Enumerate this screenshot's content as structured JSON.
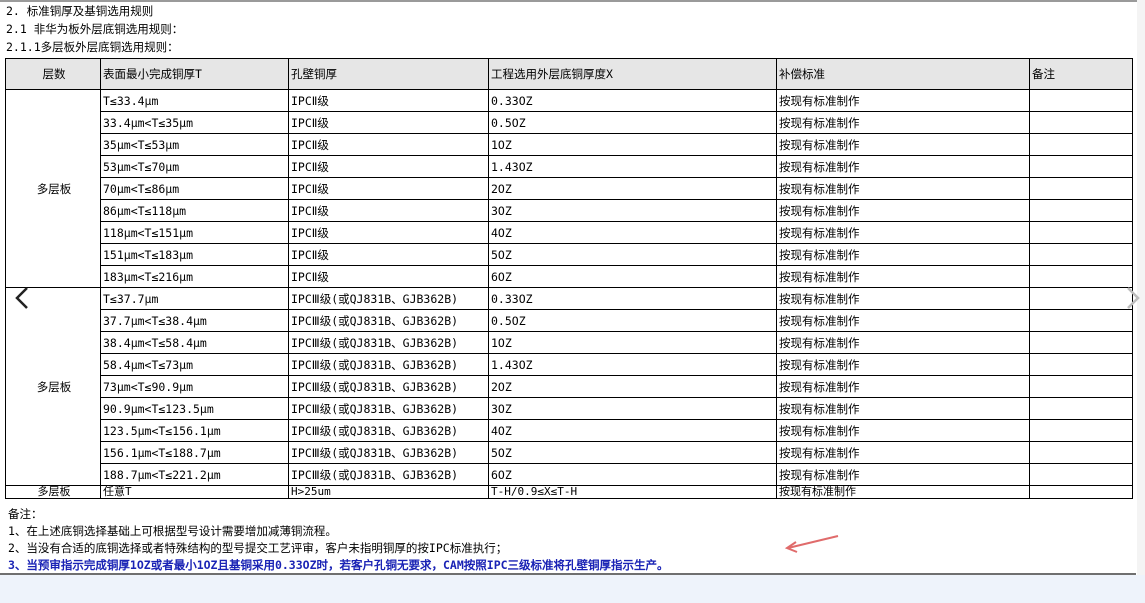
{
  "headings": [
    "2. 标准铜厚及基铜选用规则",
    "2.1 非华为板外层底铜选用规则：",
    "2.1.1多层板外层底铜选用规则："
  ],
  "table": {
    "columns": [
      "层数",
      "表面最小完成铜厚T",
      "孔壁铜厚",
      "工程选用外层底铜厚度X",
      "补偿标准",
      "备注"
    ],
    "groups": [
      {
        "layer": "多层板",
        "rows": [
          [
            "T≤33.4μm",
            "IPCⅡ级",
            "0.33OZ",
            "按现有标准制作",
            ""
          ],
          [
            "33.4μm<T≤35μm",
            "IPCⅡ级",
            "0.5OZ",
            "按现有标准制作",
            ""
          ],
          [
            "35μm<T≤53μm",
            "IPCⅡ级",
            "1OZ",
            "按现有标准制作",
            ""
          ],
          [
            "53μm<T≤70μm",
            "IPCⅡ级",
            "1.43OZ",
            "按现有标准制作",
            ""
          ],
          [
            "70μm<T≤86μm",
            "IPCⅡ级",
            "2OZ",
            "按现有标准制作",
            ""
          ],
          [
            "86μm<T≤118μm",
            "IPCⅡ级",
            "3OZ",
            "按现有标准制作",
            ""
          ],
          [
            "118μm<T≤151μm",
            "IPCⅡ级",
            "4OZ",
            "按现有标准制作",
            ""
          ],
          [
            "151μm<T≤183μm",
            "IPCⅡ级",
            "5OZ",
            "按现有标准制作",
            ""
          ],
          [
            "183μm<T≤216μm",
            "IPCⅡ级",
            "6OZ",
            "按现有标准制作",
            ""
          ]
        ]
      },
      {
        "layer": "多层板",
        "rows": [
          [
            "T≤37.7μm",
            "IPCⅢ级(或QJ831B、GJB362B)",
            "0.33OZ",
            "按现有标准制作",
            ""
          ],
          [
            "37.7μm<T≤38.4μm",
            "IPCⅢ级(或QJ831B、GJB362B)",
            "0.5OZ",
            "按现有标准制作",
            ""
          ],
          [
            "38.4μm<T≤58.4μm",
            "IPCⅢ级(或QJ831B、GJB362B)",
            "1OZ",
            "按现有标准制作",
            ""
          ],
          [
            "58.4μm<T≤73μm",
            "IPCⅢ级(或QJ831B、GJB362B)",
            "1.43OZ",
            "按现有标准制作",
            ""
          ],
          [
            "73μm<T≤90.9μm",
            "IPCⅢ级(或QJ831B、GJB362B)",
            "2OZ",
            "按现有标准制作",
            ""
          ],
          [
            "90.9μm<T≤123.5μm",
            "IPCⅢ级(或QJ831B、GJB362B)",
            "3OZ",
            "按现有标准制作",
            ""
          ],
          [
            "123.5μm<T≤156.1μm",
            "IPCⅢ级(或QJ831B、GJB362B)",
            "4OZ",
            "按现有标准制作",
            ""
          ],
          [
            "156.1μm<T≤188.7μm",
            "IPCⅢ级(或QJ831B、GJB362B)",
            "5OZ",
            "按现有标准制作",
            ""
          ],
          [
            "188.7μm<T≤221.2μm",
            "IPCⅢ级(或QJ831B、GJB362B)",
            "6OZ",
            "按现有标准制作",
            ""
          ]
        ]
      },
      {
        "layer": "多层板",
        "rows": [
          [
            "任意T",
            "H>25um",
            "T-H/0.9≤X≤T-H",
            "按现有标准制作",
            ""
          ]
        ]
      }
    ]
  },
  "notes": {
    "title": "备注：",
    "items": [
      "1、在上述底铜选择基础上可根据型号设计需要增加减薄铜流程。",
      "2、当没有合适的底铜选择或者特殊结构的型号提交工艺评审，客户未指明铜厚的按IPC标准执行；",
      "3、当预审指示完成铜厚1OZ或者最小1OZ且基铜采用0.33OZ时，若客户孔铜无要求，CAM按照IPC三级标准将孔壁铜厚指示生产。"
    ]
  },
  "colors": {
    "highlight_note": "#1a23b5",
    "pointer_arrow": "#e06b6b"
  },
  "nav": {
    "prev_icon": "chevron-left-icon",
    "next_icon": "chevron-right-icon"
  }
}
